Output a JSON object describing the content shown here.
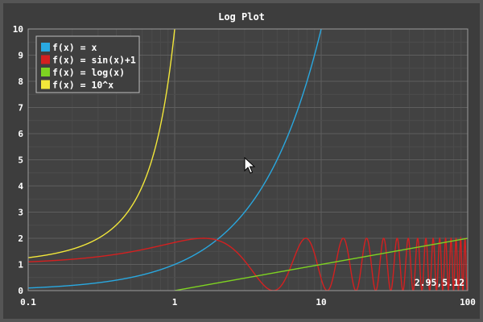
{
  "chart_data": {
    "type": "line",
    "title": "Log Plot",
    "xscale": "log",
    "xlim": [
      0.1,
      100
    ],
    "ylim": [
      0,
      10
    ],
    "grid": true,
    "legend_position": "top-left",
    "xticks": [
      "0.1",
      "1",
      "10",
      "100"
    ],
    "yticks": [
      "0",
      "1",
      "2",
      "3",
      "4",
      "5",
      "6",
      "7",
      "8",
      "9",
      "10"
    ],
    "series": [
      {
        "name": "f(x) = x",
        "color": "#29a8e0",
        "function": "x"
      },
      {
        "name": "f(x) = sin(x)+1",
        "color": "#d42020",
        "function": "sin(x)+1"
      },
      {
        "name": "f(x) = log(x)",
        "color": "#7ed321",
        "function": "log(x)"
      },
      {
        "name": "f(x) = 10^x",
        "color": "#f2e73a",
        "function": "10^x"
      }
    ],
    "mouse_readout": "2.95,5.12"
  },
  "colors": {
    "plot_bg": "#424242",
    "grid_minor": "#4c4c4c",
    "grid_major": "#5e5e5e",
    "frame": "#9a9a9a",
    "legend_bg": "#3f3f3f",
    "legend_border": "#bdbdbd"
  }
}
